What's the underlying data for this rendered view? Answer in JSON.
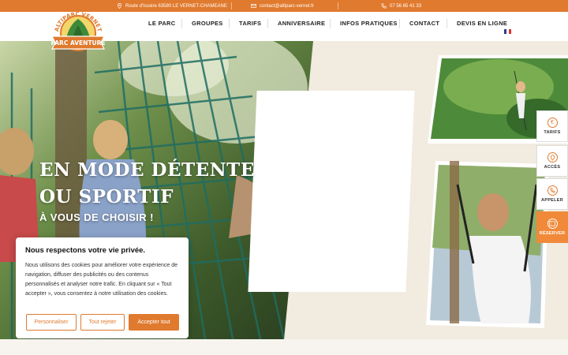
{
  "topbar": {
    "address": "Route d'Issoire 63580 LE VERNET-CHAMEANE",
    "email": "contact@altiparc-vernet.fr",
    "phone": "07 56 85 41 33"
  },
  "logo": {
    "top_text": "ALTIPARC VERNET",
    "banner_text": "PARC AVENTURE"
  },
  "nav": {
    "items": [
      "LE PARC",
      "GROUPES",
      "TARIFS",
      "ANNIVERSAIRE",
      "INFOS PRATIQUES",
      "CONTACT",
      "DEVIS EN LIGNE"
    ],
    "language": "fr"
  },
  "hero": {
    "title_line1": "EN MODE DÉTENTE",
    "title_line2": "OU SPORTIF",
    "subtitle": "À VOUS DE CHOISIR !"
  },
  "side_actions": [
    {
      "label": "TARIFS",
      "icon": "euro-icon"
    },
    {
      "label": "ACCÈS",
      "icon": "map-pin-icon"
    },
    {
      "label": "APPELER",
      "icon": "phone-icon"
    },
    {
      "label": "RÉSERVER",
      "icon": "ticket-icon"
    }
  ],
  "cookie": {
    "title": "Nous respectons votre vie privée.",
    "text": "Nous utilisons des cookies pour améliorer votre expérience de navigation, diffuser des publicités ou des contenus personnalisés et analyser notre trafic. En cliquant sur « Tout accepter », vous consentez à notre utilisation des cookies.",
    "btn_customize": "Personnaliser",
    "btn_reject": "Tout rejeter",
    "btn_accept": "Accepter tout"
  },
  "colors": {
    "accent": "#e07a2e",
    "background": "#f1ebe0"
  }
}
